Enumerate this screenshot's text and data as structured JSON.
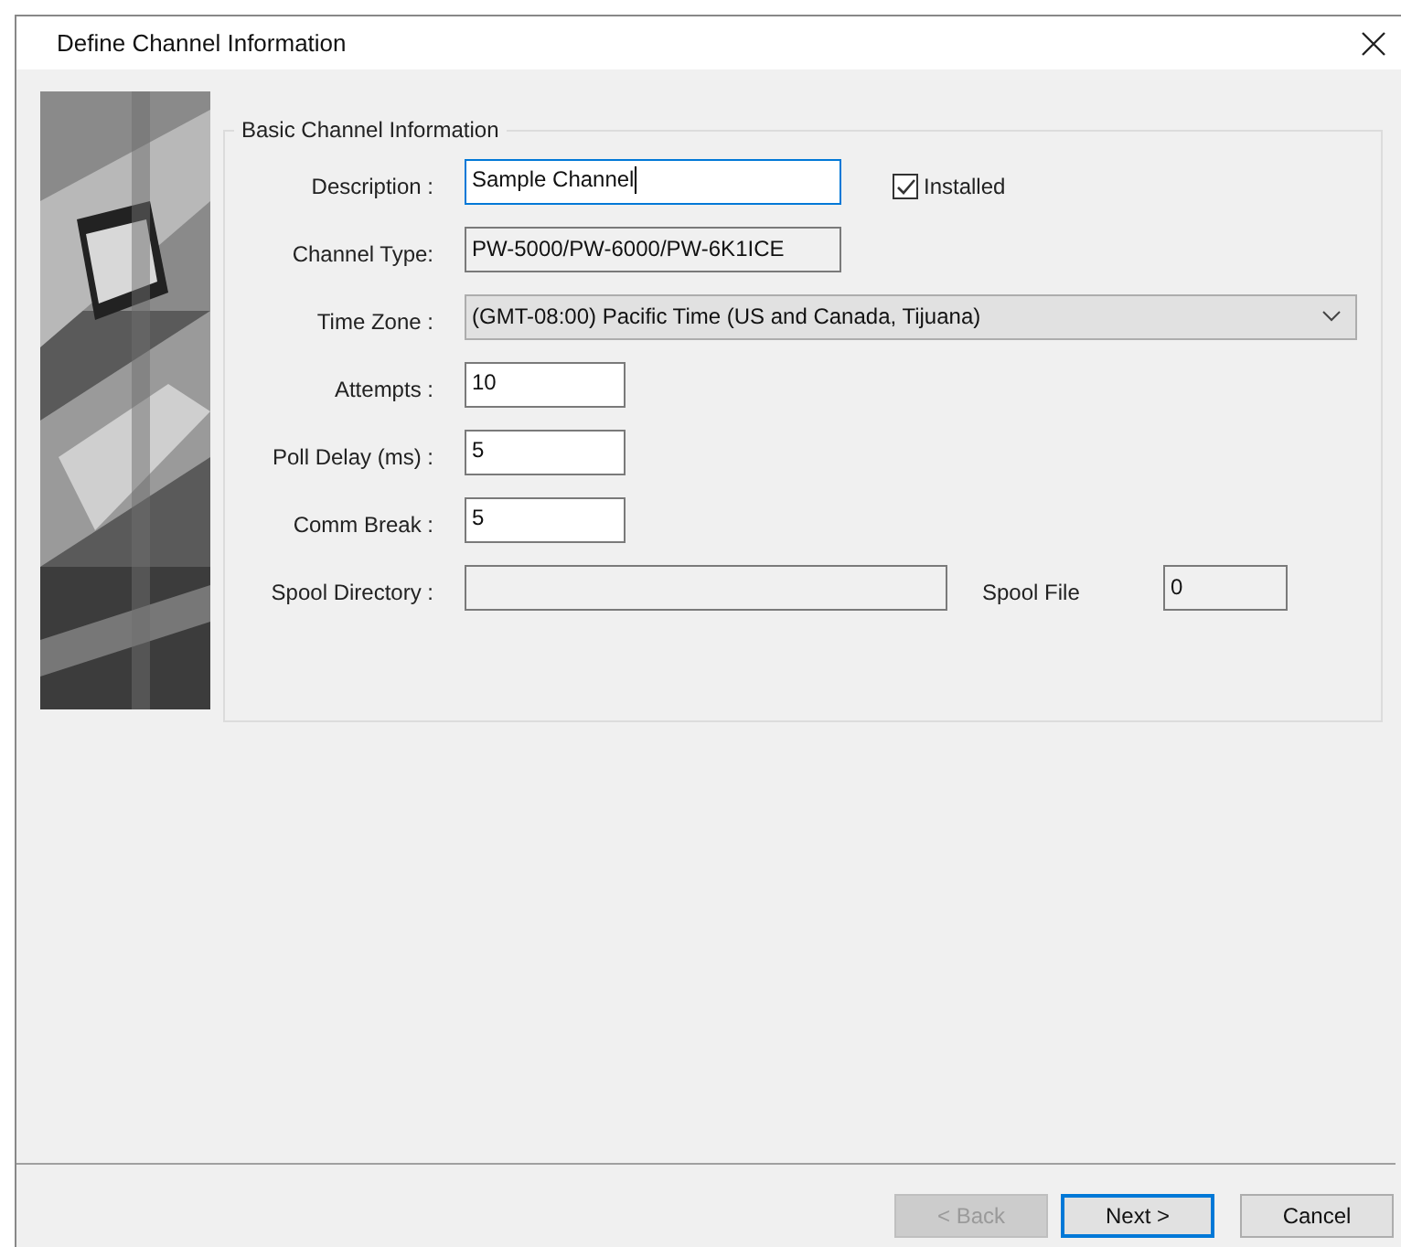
{
  "window": {
    "title": "Define Channel Information"
  },
  "group": {
    "title": "Basic Channel Information",
    "rows": [
      {
        "kind": "text",
        "label": "Description :",
        "value": "Sample Channel",
        "focused": true,
        "checkbox": {
          "label": "Installed",
          "checked": true
        }
      },
      {
        "kind": "readonly",
        "label": "Channel Type:",
        "value": "PW-5000/PW-6000/PW-6K1ICE",
        "focused": false
      },
      {
        "kind": "dropdown",
        "label": "Time Zone :",
        "value": "(GMT-08:00) Pacific Time (US and Canada, Tijuana)",
        "focused": false
      },
      {
        "kind": "short",
        "label": "Attempts :",
        "value": "10",
        "focused": false
      },
      {
        "kind": "short",
        "label": "Poll Delay (ms) :",
        "value": "5",
        "focused": false
      },
      {
        "kind": "short",
        "label": "Comm Break :",
        "value": "5",
        "focused": false
      },
      {
        "kind": "spool",
        "label": "Spool Directory :",
        "value": "",
        "focused": false,
        "extra_label": "Spool File",
        "extra_value": "0"
      }
    ]
  },
  "buttons": [
    {
      "label": "< Back",
      "disabled": true,
      "focused": false
    },
    {
      "label": "Next >",
      "disabled": false,
      "focused": true
    },
    {
      "label": "Cancel",
      "disabled": false,
      "focused": false
    }
  ]
}
